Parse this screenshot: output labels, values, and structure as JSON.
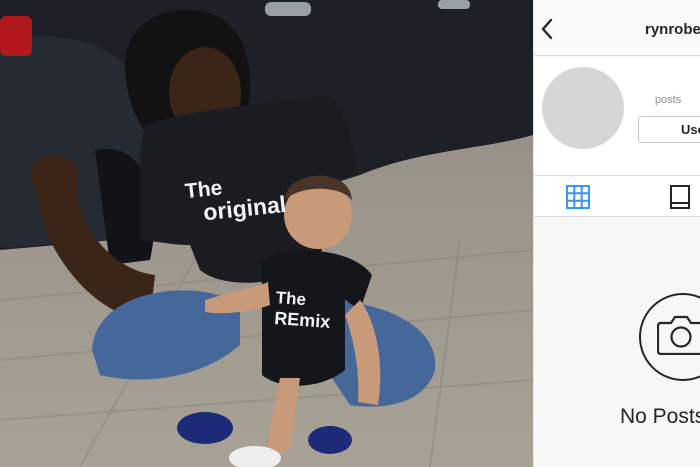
{
  "profile": {
    "username": "rynrobe",
    "stat_label": "posts",
    "follow_button_label": "Use",
    "empty_state_title": "No Posts"
  },
  "photo": {
    "mother_shirt_line1": "The",
    "mother_shirt_line2": "original",
    "child_shirt_line1": "The",
    "child_shirt_line2": "REmix"
  },
  "icons": {
    "back": "chevron-left-icon",
    "grid_tab": "grid-icon",
    "single_tab": "single-post-icon",
    "camera": "camera-icon"
  },
  "colors": {
    "active_tab": "#3897f0",
    "text": "#262626",
    "muted": "#8e8e8e"
  }
}
